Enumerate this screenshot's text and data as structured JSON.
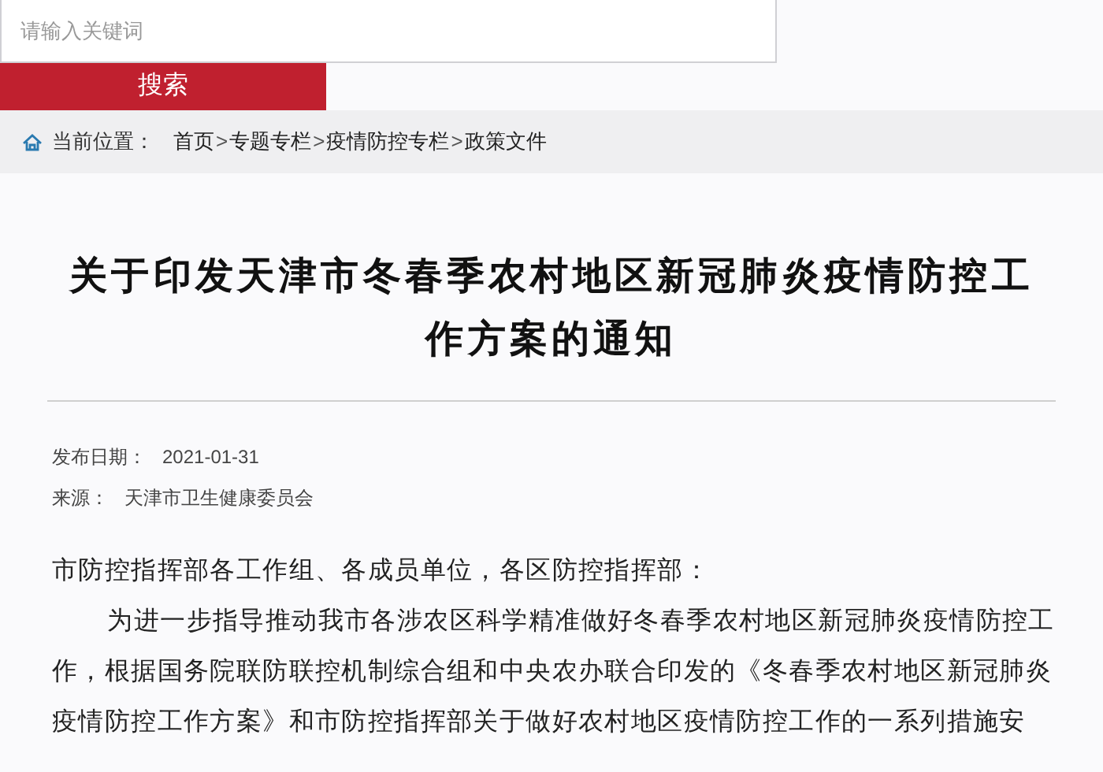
{
  "search": {
    "placeholder": "请输入关键词",
    "button": "搜索"
  },
  "breadcrumb": {
    "label": "当前位置：",
    "items": [
      {
        "kind": "link",
        "text": "首页"
      },
      {
        "kind": "separator",
        "text": ">"
      },
      {
        "kind": "link",
        "text": "专题专栏"
      },
      {
        "kind": "separator",
        "text": ">"
      },
      {
        "kind": "link",
        "text": "疫情防控专栏"
      },
      {
        "kind": "separator",
        "text": ">"
      },
      {
        "kind": "link",
        "text": "政策文件"
      }
    ]
  },
  "article": {
    "title": "关于印发天津市冬春季农村地区新冠肺炎疫情防控工作方案的通知",
    "meta": [
      {
        "label": "发布日期：",
        "value": "2021-01-31"
      },
      {
        "label": "来源：",
        "value": "天津市卫生健康委员会"
      }
    ],
    "salutation": "市防控指挥部各工作组、各成员单位，各区防控指挥部：",
    "paragraphs": [
      "为进一步指导推动我市各涉农区科学精准做好冬春季农村地区新冠肺炎疫情防控工作，根据国务院联防联控机制综合组和中央农办联合印发的《冬春季农村地区新冠肺炎疫情防控工作方案》和市防控指挥部关于做好农村地区疫情防控工作的一系列措施安"
    ]
  }
}
